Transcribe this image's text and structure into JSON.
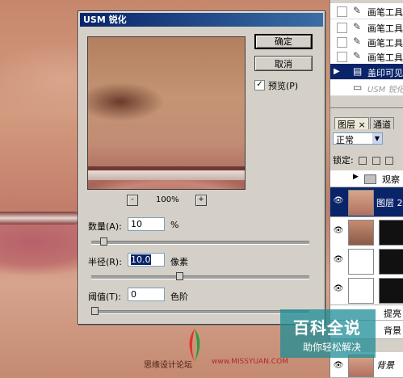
{
  "dialog": {
    "title": "USM 锐化",
    "ok_label": "确定",
    "cancel_label": "取消",
    "preview_label": "预览(P)",
    "preview_checked": true,
    "zoom_minus": "-",
    "zoom_plus": "+",
    "zoom_level": "100%",
    "amount": {
      "label": "数量(A):",
      "value": "10",
      "unit": "%",
      "slider_fraction": 0.04
    },
    "radius": {
      "label": "半径(R):",
      "value": "10.0",
      "unit": "像素",
      "slider_fraction": 0.39
    },
    "threshold": {
      "label": "阈值(T):",
      "value": "0",
      "unit": "色阶",
      "slider_fraction": 0.0
    }
  },
  "history": {
    "items": [
      {
        "label": "画笔工具"
      },
      {
        "label": "画笔工具"
      },
      {
        "label": "画笔工具"
      },
      {
        "label": "画笔工具"
      },
      {
        "label": "盖印可见"
      },
      {
        "label": "USM 锐化"
      }
    ],
    "selected_index": 4
  },
  "layers_panel": {
    "tab_layers": "图层",
    "tab_channels": "通道",
    "blend_mode": "正常",
    "lock_label": "锁定:",
    "group_name": "观察",
    "layer_selected": "图层 2",
    "layer_lighten": "提亮",
    "layer_copy": "背景 副",
    "layer_background": "背景"
  },
  "watermarks": {
    "baike_title": "百科全说",
    "baike_subtitle": "助你轻松解决",
    "site_name": "思缘设计论坛",
    "site_url": "www.MISSYUAN.COM"
  }
}
